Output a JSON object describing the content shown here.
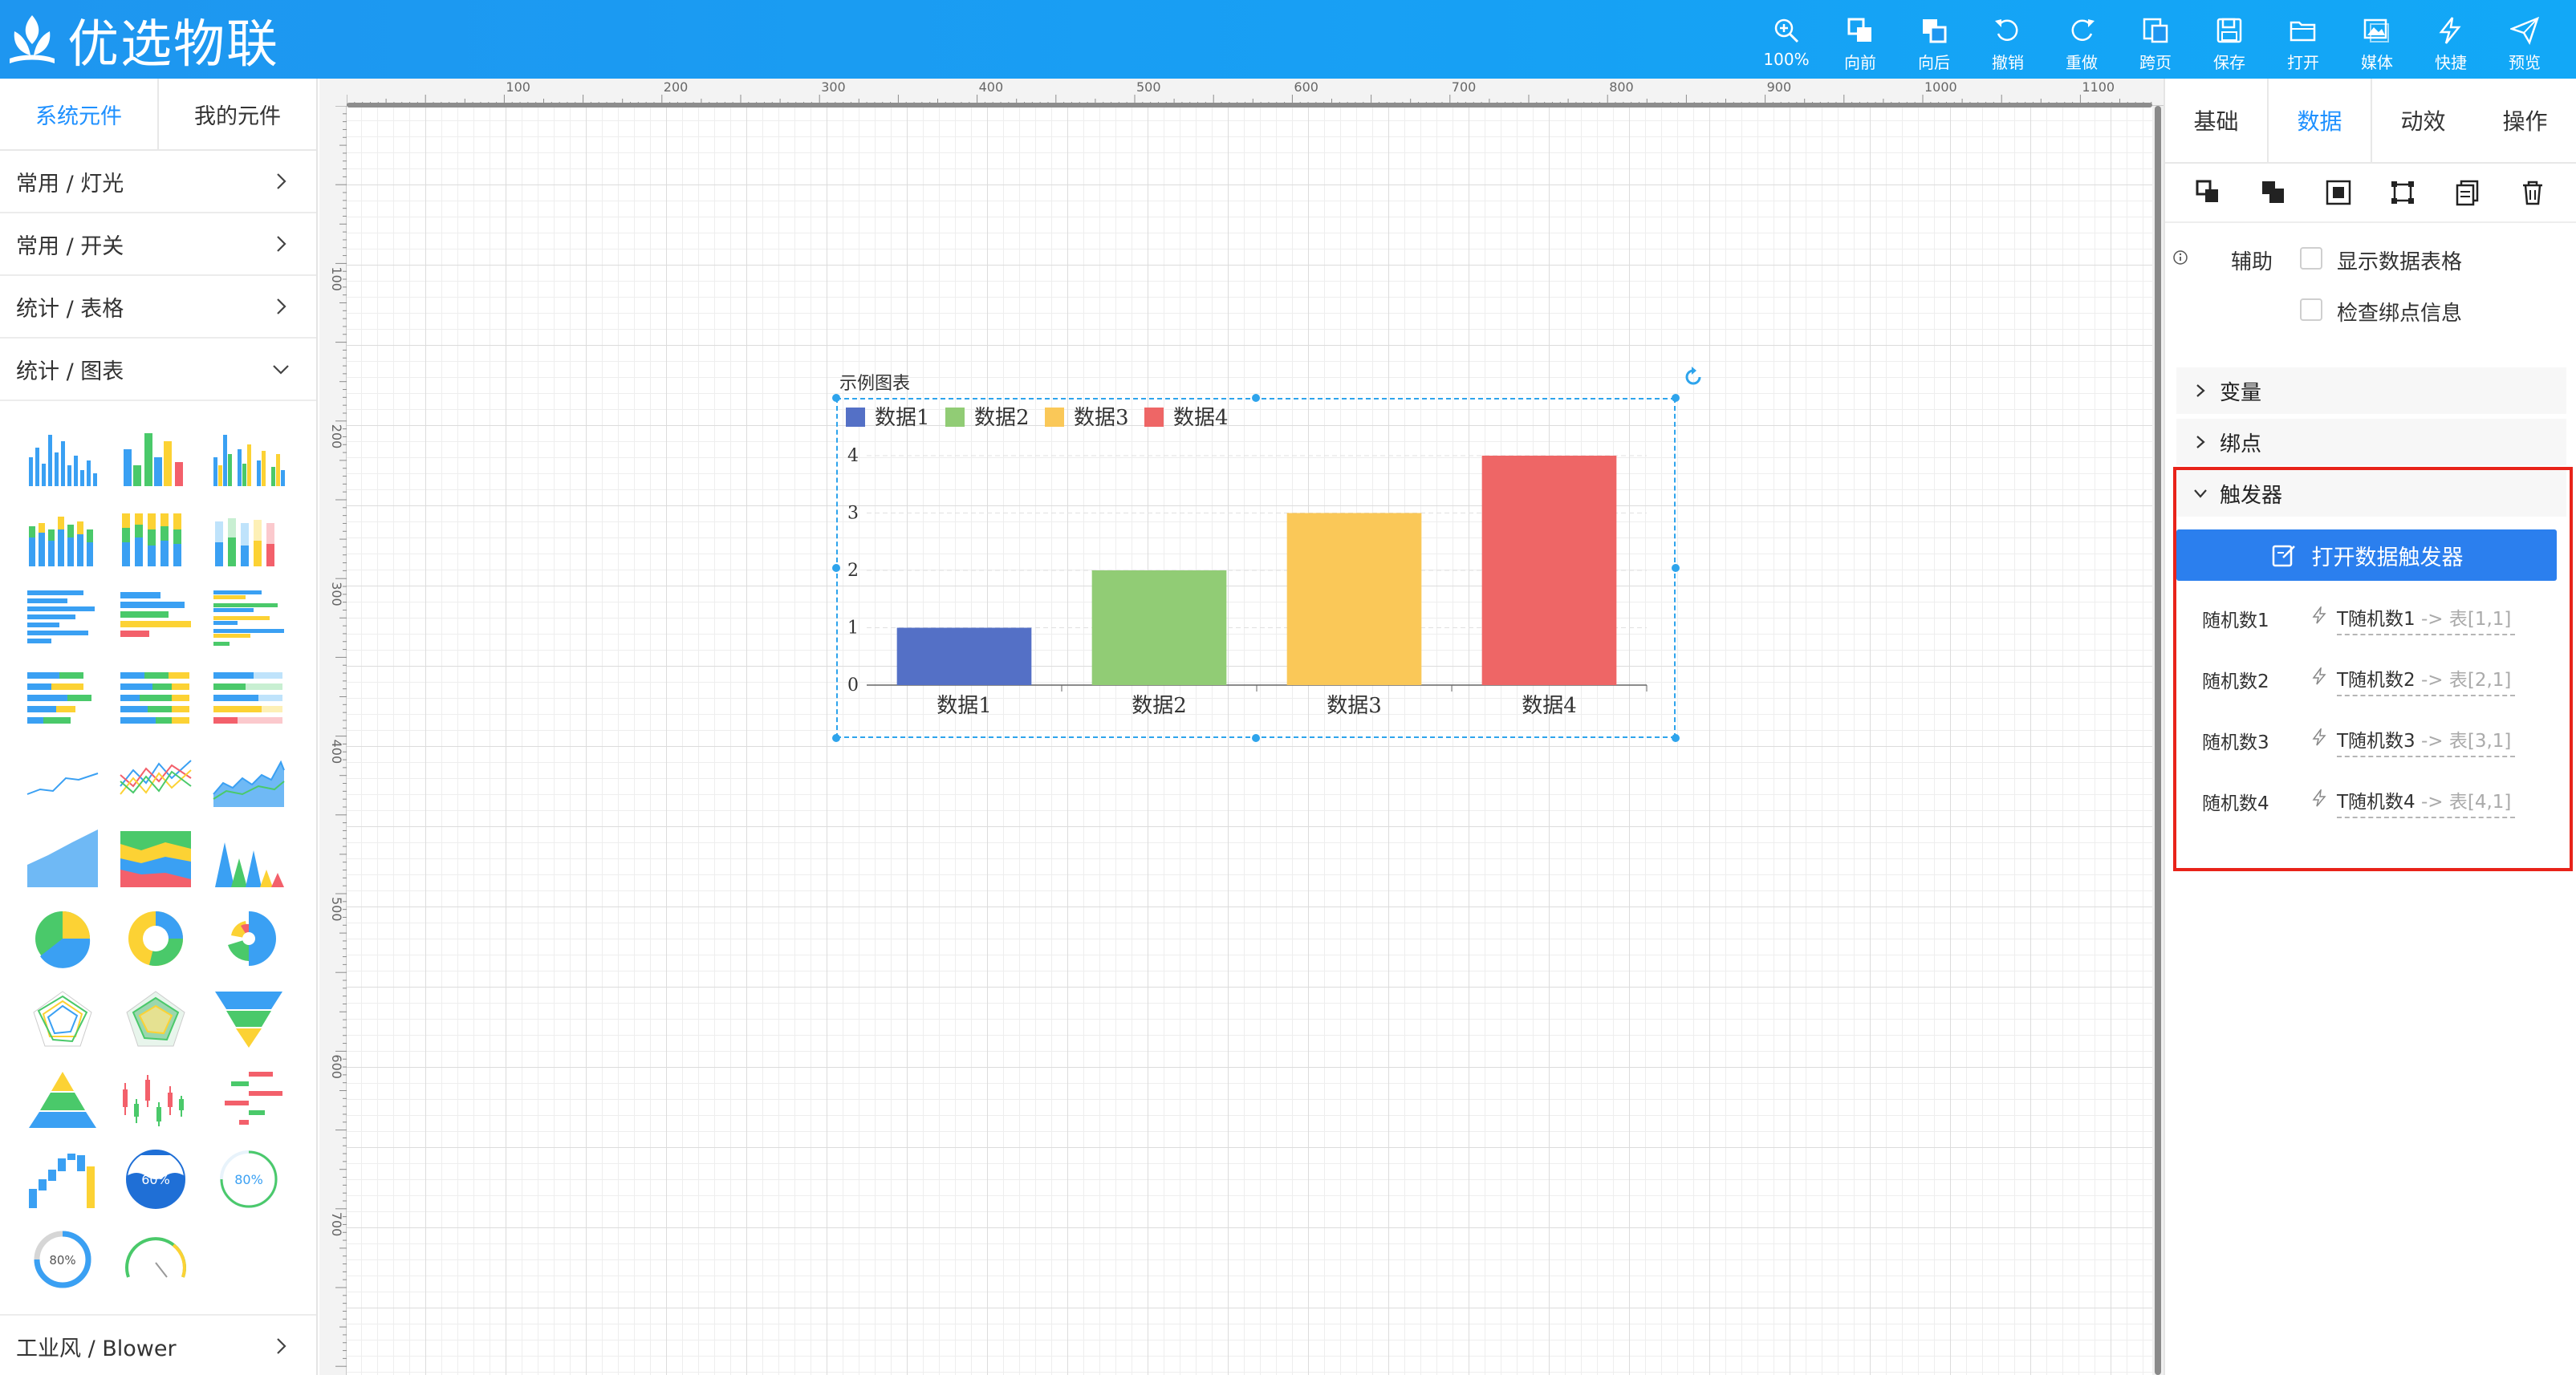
{
  "app": {
    "title": "优选物联"
  },
  "toolbar": [
    {
      "id": "zoom",
      "label": "100%",
      "icon": "zoom-in-icon"
    },
    {
      "id": "forward",
      "label": "向前",
      "icon": "bring-forward-icon"
    },
    {
      "id": "backward",
      "label": "向后",
      "icon": "send-backward-icon"
    },
    {
      "id": "undo",
      "label": "撤销",
      "icon": "undo-icon"
    },
    {
      "id": "redo",
      "label": "重做",
      "icon": "redo-icon"
    },
    {
      "id": "jump",
      "label": "跨页",
      "icon": "cross-page-icon"
    },
    {
      "id": "save",
      "label": "保存",
      "icon": "save-icon"
    },
    {
      "id": "open",
      "label": "打开",
      "icon": "folder-open-icon"
    },
    {
      "id": "media",
      "label": "媒体",
      "icon": "media-icon"
    },
    {
      "id": "quick",
      "label": "快捷",
      "icon": "lightning-icon"
    },
    {
      "id": "preview",
      "label": "预览",
      "icon": "send-icon"
    }
  ],
  "left": {
    "tabs": [
      "系统元件",
      "我的元件"
    ],
    "categories": [
      "常用 / 灯光",
      "常用 / 开关",
      "统计 / 表格",
      "统计 / 图表"
    ],
    "bottom_category": "工业风 / Blower",
    "thumb_labels": {
      "gauge_a": "60%",
      "gauge_b": "80%",
      "gauge_c": "80%"
    }
  },
  "canvas": {
    "ruler_top": [
      "100",
      "200",
      "300",
      "400",
      "500",
      "600",
      "700",
      "800",
      "900",
      "1000",
      "1100"
    ],
    "ruler_left": [
      "100",
      "200",
      "300",
      "400",
      "500",
      "600",
      "700"
    ]
  },
  "chart_data": {
    "type": "bar",
    "title": "示例图表",
    "categories": [
      "数据1",
      "数据2",
      "数据3",
      "数据4"
    ],
    "values": [
      1,
      2,
      3,
      4
    ],
    "colors": [
      "#5470c6",
      "#91cc75",
      "#fac858",
      "#ee6666"
    ],
    "legend": [
      "数据1",
      "数据2",
      "数据3",
      "数据4"
    ],
    "legend_position": "top-left",
    "yticks": [
      "0",
      "1",
      "2",
      "3",
      "4"
    ],
    "ylim": [
      0,
      4
    ],
    "grid": true
  },
  "right": {
    "tabs": [
      "基础",
      "数据",
      "动效",
      "操作"
    ],
    "active_tab": "数据",
    "assist_label": "辅助",
    "checkbox_show_table": "显示数据表格",
    "checkbox_check_binding": "检查绑点信息",
    "section_variables": "变量",
    "section_bindings": "绑点",
    "section_triggers": "触发器",
    "open_trigger_button": "打开数据触发器",
    "triggers": [
      {
        "name": "随机数1",
        "value": "T随机数1",
        "map": "-> 表[1,1]"
      },
      {
        "name": "随机数2",
        "value": "T随机数2",
        "map": "-> 表[2,1]"
      },
      {
        "name": "随机数3",
        "value": "T随机数3",
        "map": "-> 表[3,1]"
      },
      {
        "name": "随机数4",
        "value": "T随机数4",
        "map": "-> 表[4,1]"
      }
    ],
    "accent": "#1e90ff",
    "highlight": "#e8231a"
  }
}
